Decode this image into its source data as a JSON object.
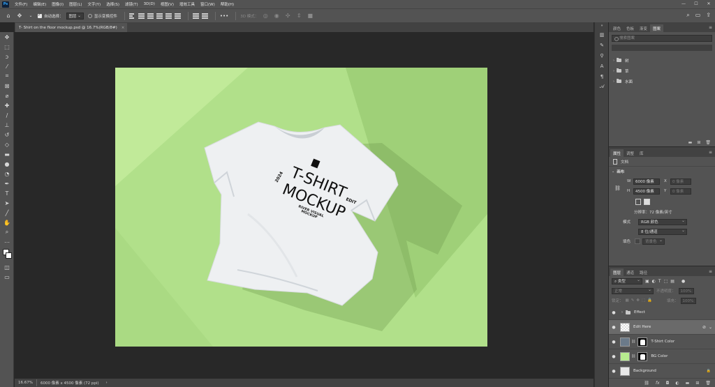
{
  "menubar": {
    "logo": "Ps",
    "items": [
      "文件(F)",
      "编辑(E)",
      "图像(I)",
      "图层(L)",
      "文字(Y)",
      "选择(S)",
      "滤镜(T)",
      "3D(D)",
      "视图(V)",
      "增效工具",
      "窗口(W)",
      "帮助(H)"
    ],
    "win_min": "—",
    "win_max": "☐",
    "win_close": "✕"
  },
  "options": {
    "auto_select_label": "自动选择：",
    "auto_select_target": "图层",
    "show_transform_label": "显示变换控件",
    "more": "•••",
    "mode_3d_label": "3D 模式："
  },
  "document": {
    "tab_title": "T- Shirt on the floor mockup.psd @ 16.7%(RGB/8#)",
    "tab_close": "×"
  },
  "mockup": {
    "year": "2024",
    "title_line1": "T-SHIRT",
    "title_line2": "MOCKUP",
    "edit": "EDIT",
    "river_line1": "RIVER VISUAL",
    "river_line2": "MOCKUP",
    "logo_letter": "R"
  },
  "status": {
    "zoom": "16.67%",
    "info": "6000 像素 x 4500 像素 (72 ppi)",
    "arrow": "›"
  },
  "libraries_panel": {
    "tabs": [
      "颜色",
      "色板",
      "渐变",
      "图案"
    ],
    "active_tab": 3,
    "search_placeholder": "搜索图案",
    "groups": [
      "树",
      "草",
      "水面"
    ]
  },
  "properties_panel": {
    "tabs": [
      "属性",
      "调整",
      "库"
    ],
    "active_tab": 0,
    "doc_label": "文档",
    "canvas_label": "画布",
    "w_label": "W",
    "w_value": "6000 像素",
    "h_label": "H",
    "h_value": "4500 像素",
    "x_label": "X",
    "y_label": "Y",
    "x_placeholder": "0 像素",
    "y_placeholder": "0 像素",
    "resolution": "分辨率：72 像素/英寸",
    "mode_label": "模式",
    "mode_value": "RGB 颜色",
    "depth_value": "8 位/通道",
    "fill_label": "填色",
    "fill_value": "背景色"
  },
  "layers_panel": {
    "tabs": [
      "图层",
      "通道",
      "路径"
    ],
    "active_tab": 0,
    "filter_value": "类型",
    "blend_mode": "正常",
    "opacity_label": "不透明度：",
    "opacity_value": "100%",
    "lock_label": "锁定：",
    "fill_label": "填充：",
    "fill_value": "100%",
    "layers": [
      {
        "name": "Effect",
        "type": "group"
      },
      {
        "name": "Edit Here",
        "type": "smart",
        "selected": true
      },
      {
        "name": "T-Shirt Color",
        "type": "color",
        "thumb_color": "#6b7a89"
      },
      {
        "name": "BG Color",
        "type": "color",
        "thumb_color": "#b7ec8f"
      },
      {
        "name": "Background",
        "type": "background"
      }
    ],
    "footer_icons": [
      "link-icon",
      "fx",
      "mask-icon",
      "adjust-icon",
      "folder-icon",
      "new-layer-icon",
      "trash-icon"
    ]
  },
  "colors": {
    "canvas_green": "#b1e08a",
    "accent_blue": "#31a8ff",
    "panel_bg": "#535353"
  }
}
